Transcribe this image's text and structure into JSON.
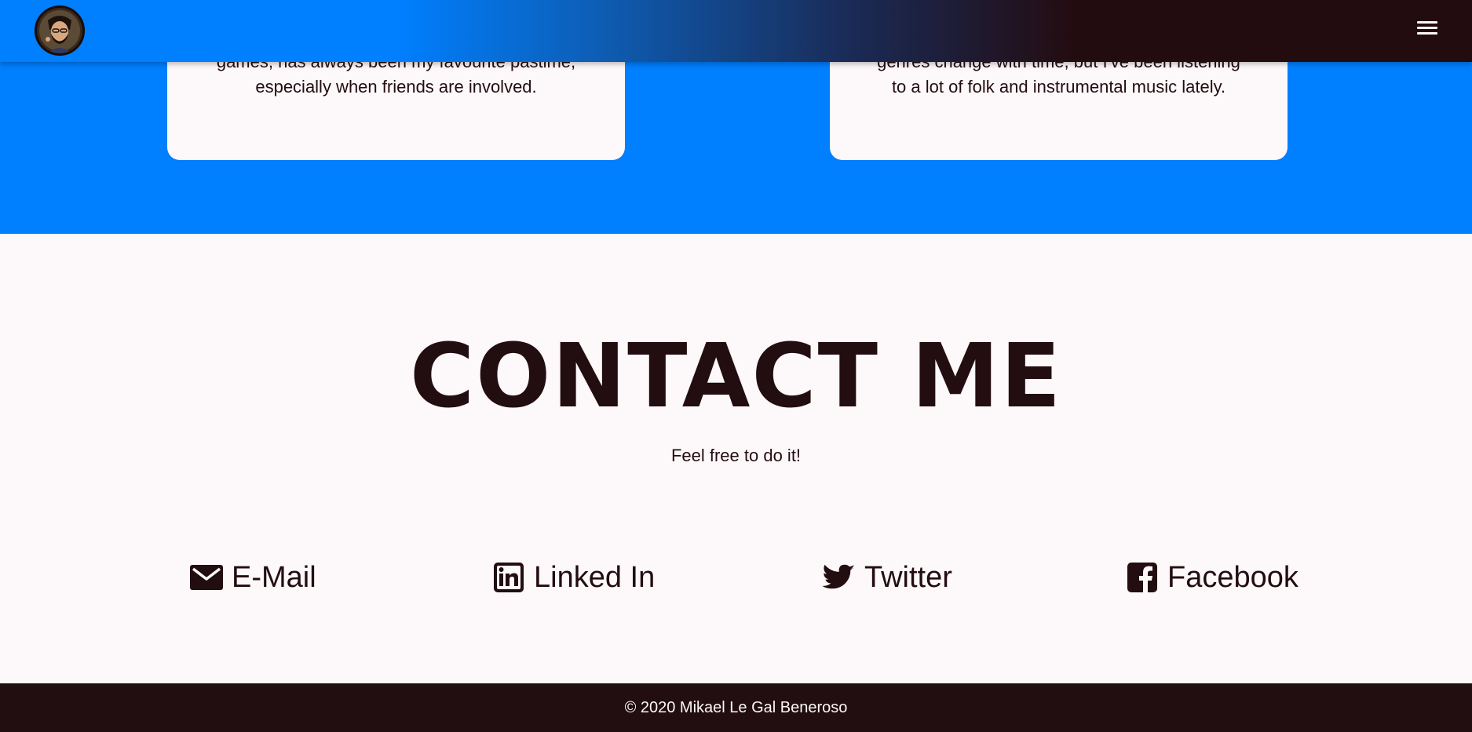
{
  "header": {
    "menu_icon": "hamburger-menu-icon",
    "avatar_icon": "avatar-portrait"
  },
  "cards": [
    {
      "text": "games, has always been my favourite pastime, especially when friends are involved."
    },
    {
      "text": "genres change with time, but I've been listening to a lot of folk and instrumental music lately."
    }
  ],
  "contact": {
    "title": "CONTACT ME",
    "subtitle": "Feel free to do it!",
    "links": [
      {
        "label": "E-Mail",
        "icon": "envelope-icon"
      },
      {
        "label": "Linked In",
        "icon": "linkedin-icon"
      },
      {
        "label": "Twitter",
        "icon": "twitter-icon"
      },
      {
        "label": "Facebook",
        "icon": "facebook-icon"
      }
    ]
  },
  "footer": {
    "copyright": "© 2020 Mikael Le Gal Beneroso"
  },
  "colors": {
    "primary_blue": "#007ffe",
    "dark": "#220d10",
    "light": "#fdf8fa"
  }
}
